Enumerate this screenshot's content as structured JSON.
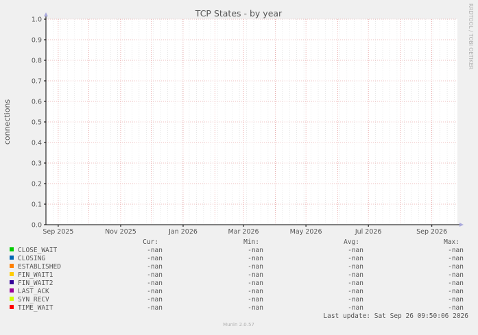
{
  "colors": {
    "background": "#f0f0f0",
    "plot_background": "#ffffff",
    "major_grid": "#e08080",
    "minor_grid": "#d8d8d8",
    "axis": "#000000",
    "text": "#555555",
    "watermark": "#b0b0b0",
    "arrow": "#aaaadd"
  },
  "watermark": "RRDTOOL / TOBI OETIKER",
  "legend_headers": {
    "cur": "Cur:",
    "min": "Min:",
    "avg": "Avg:",
    "max": "Max:"
  },
  "last_update": "Last update: Sat Sep 26 09:50:06 2026",
  "footer": "Munin 2.0.57",
  "chart_data": {
    "type": "line",
    "title": "TCP States - by year",
    "ylabel": "connections",
    "xlabel": "",
    "ylim": [
      0.0,
      1.0
    ],
    "y_ticks": [
      "0.0",
      "0.1",
      "0.2",
      "0.3",
      "0.4",
      "0.5",
      "0.6",
      "0.7",
      "0.8",
      "0.9",
      "1.0"
    ],
    "x_ticks": [
      {
        "label": "Sep 2025",
        "date": "2025-09-01"
      },
      {
        "label": "Nov 2025",
        "date": "2025-11-01"
      },
      {
        "label": "Jan 2026",
        "date": "2026-01-01"
      },
      {
        "label": "Mar 2026",
        "date": "2026-03-01"
      },
      {
        "label": "May 2026",
        "date": "2026-05-01"
      },
      {
        "label": "Jul 2026",
        "date": "2026-07-01"
      },
      {
        "label": "Sep 2026",
        "date": "2026-09-01"
      }
    ],
    "grid": true,
    "series": [
      {
        "name": "CLOSE_WAIT",
        "color": "#00cc00",
        "cur": "-nan",
        "min": "-nan",
        "avg": "-nan",
        "max": "-nan",
        "values": []
      },
      {
        "name": "CLOSING",
        "color": "#0066b3",
        "cur": "-nan",
        "min": "-nan",
        "avg": "-nan",
        "max": "-nan",
        "values": []
      },
      {
        "name": "ESTABLISHED",
        "color": "#ff8000",
        "cur": "-nan",
        "min": "-nan",
        "avg": "-nan",
        "max": "-nan",
        "values": []
      },
      {
        "name": "FIN_WAIT1",
        "color": "#ffcc00",
        "cur": "-nan",
        "min": "-nan",
        "avg": "-nan",
        "max": "-nan",
        "values": []
      },
      {
        "name": "FIN_WAIT2",
        "color": "#330099",
        "cur": "-nan",
        "min": "-nan",
        "avg": "-nan",
        "max": "-nan",
        "values": []
      },
      {
        "name": "LAST_ACK",
        "color": "#990099",
        "cur": "-nan",
        "min": "-nan",
        "avg": "-nan",
        "max": "-nan",
        "values": []
      },
      {
        "name": "SYN_RECV",
        "color": "#ccff00",
        "cur": "-nan",
        "min": "-nan",
        "avg": "-nan",
        "max": "-nan",
        "values": []
      },
      {
        "name": "TIME_WAIT",
        "color": "#ff0000",
        "cur": "-nan",
        "min": "-nan",
        "avg": "-nan",
        "max": "-nan",
        "values": []
      }
    ]
  }
}
